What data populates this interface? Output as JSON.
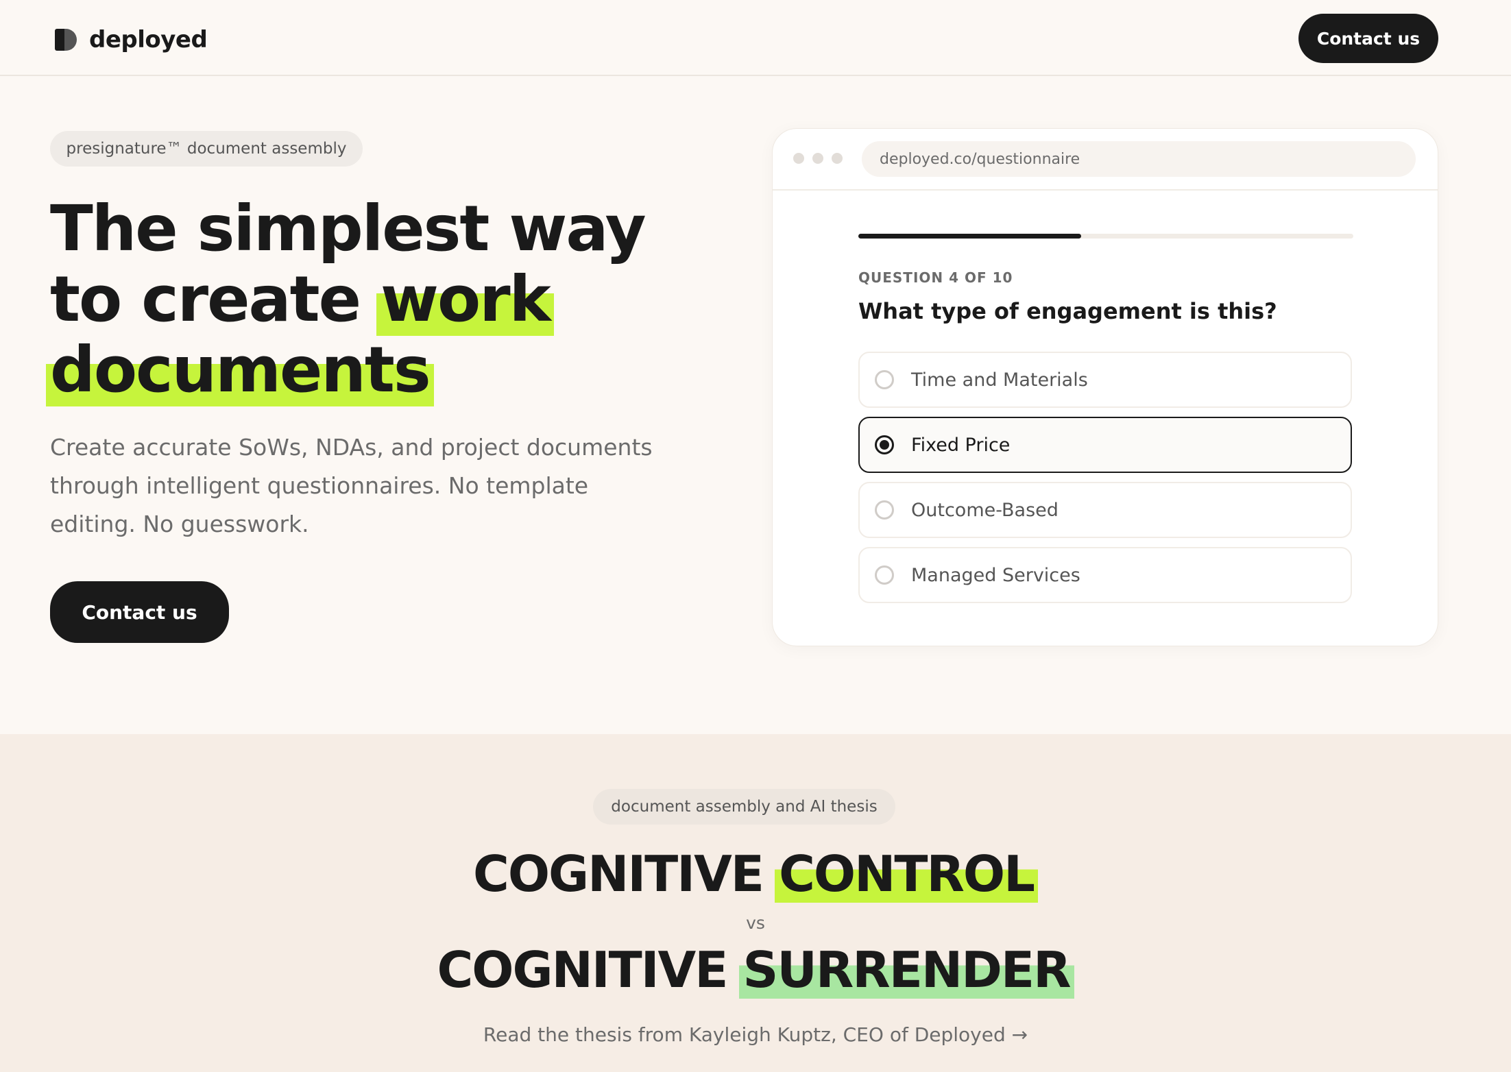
{
  "header": {
    "brand": "deployed",
    "contact_label": "Contact us"
  },
  "hero": {
    "badge": "presignature™ document assembly",
    "title_part1": "The simplest way to create ",
    "title_highlight1": "work",
    "title_highlight2": "documents",
    "subtitle": "Create accurate SoWs, NDAs, and project documents through intelligent questionnaires. No template editing. No guesswork.",
    "contact_label": "Contact us"
  },
  "questionnaire": {
    "url": "deployed.co/questionnaire",
    "progress": 0.45,
    "question_label": "QUESTION 4 OF 10",
    "question": "What type of engagement is this?",
    "options": [
      {
        "label": "Time and Materials",
        "selected": false
      },
      {
        "label": "Fixed Price",
        "selected": true
      },
      {
        "label": "Outcome-Based",
        "selected": false
      },
      {
        "label": "Managed Services",
        "selected": false
      }
    ]
  },
  "thesis": {
    "badge": "document assembly and AI thesis",
    "line1_word": "COGNITIVE",
    "line1_highlight": "CONTROL",
    "vs": "vs",
    "line2_word": "COGNITIVE",
    "line2_highlight": "SURRENDER",
    "link": "Read the thesis from Kayleigh Kuptz, CEO of Deployed →"
  },
  "colors": {
    "accent_lime": "#c6f43c",
    "accent_green": "#a8e6a1",
    "dark": "#1a1a1a",
    "background": "#fcf8f4",
    "section_bg": "#f6ede5"
  }
}
